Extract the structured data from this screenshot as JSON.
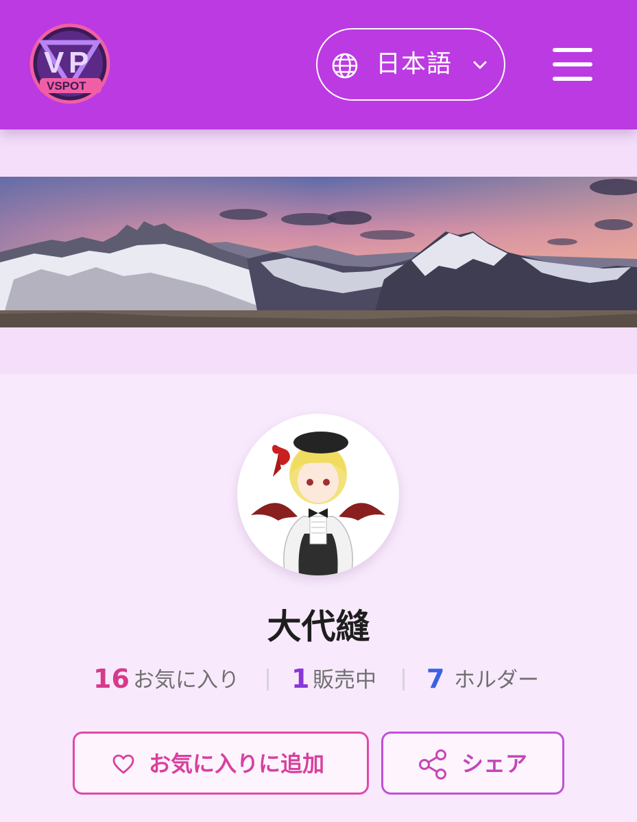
{
  "header": {
    "logo_text": "VSPOT",
    "language": {
      "label": "日本語",
      "icon": "globe-icon",
      "chevron": "chevron-down-icon"
    },
    "menu_icon": "hamburger-menu-icon"
  },
  "banner": {
    "alt": "mountain-panorama-image"
  },
  "profile": {
    "name": "大代縫",
    "stats": [
      {
        "value": "16",
        "label": "お気に入り",
        "color": "#d63a8a"
      },
      {
        "value": "1",
        "label": "販売中",
        "color": "#8a36d8"
      },
      {
        "value": "7",
        "label": "ホルダー",
        "color": "#3a62e0"
      }
    ]
  },
  "actions": {
    "favorite": {
      "label": "お気に入りに追加",
      "icon": "heart-icon"
    },
    "share": {
      "label": "シェア",
      "icon": "share-icon"
    }
  },
  "colors": {
    "header_bg": "#bc3ae2",
    "page_bg": "#f8eafc",
    "accent_pink": "#e048a8",
    "accent_purple": "#c050d8"
  }
}
